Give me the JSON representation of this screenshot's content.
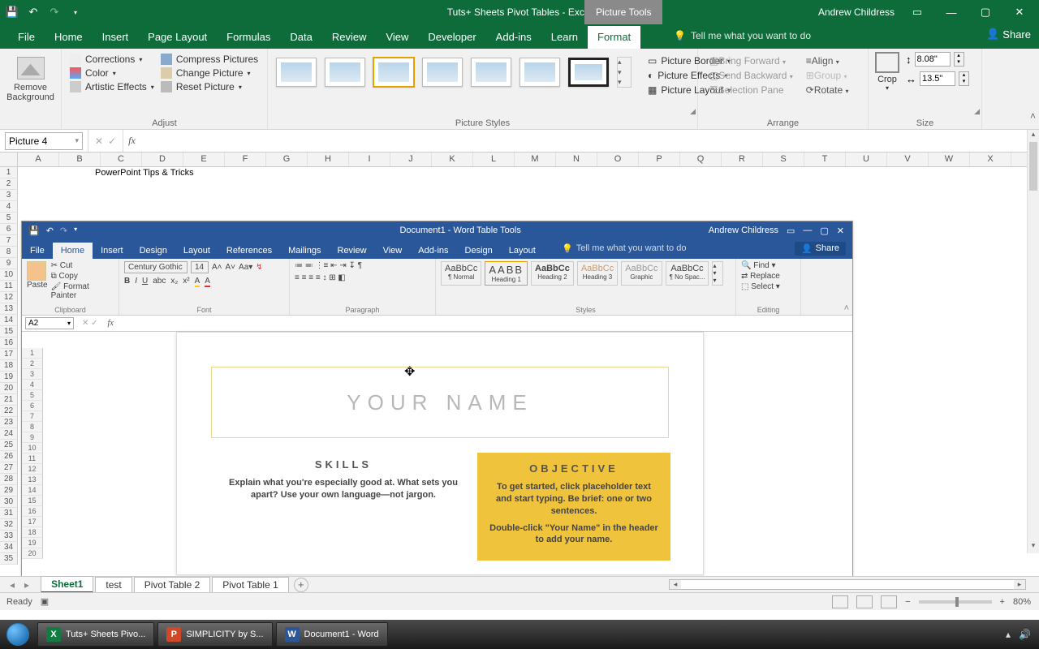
{
  "titlebar": {
    "doc_title": "Tuts+ Sheets Pivot Tables  -  Excel",
    "picture_tools": "Picture Tools",
    "user": "Andrew Childress"
  },
  "tabs": {
    "file": "File",
    "home": "Home",
    "insert": "Insert",
    "page_layout": "Page Layout",
    "formulas": "Formulas",
    "data": "Data",
    "review": "Review",
    "view": "View",
    "developer": "Developer",
    "addins": "Add-ins",
    "learn": "Learn",
    "format": "Format",
    "tell_me": "Tell me what you want to do",
    "share": "Share"
  },
  "ribbon": {
    "remove_bg": "Remove Background",
    "corrections": "Corrections",
    "color": "Color",
    "artistic": "Artistic Effects",
    "compress": "Compress Pictures",
    "change": "Change Picture",
    "reset": "Reset Picture",
    "adjust_label": "Adjust",
    "styles_label": "Picture Styles",
    "border": "Picture Border",
    "effects": "Picture Effects",
    "layout": "Picture Layout",
    "bring_fwd": "Bring Forward",
    "send_back": "Send Backward",
    "selection": "Selection Pane",
    "align": "Align",
    "group": "Group",
    "rotate": "Rotate",
    "arrange_label": "Arrange",
    "crop": "Crop",
    "height": "8.08\"",
    "width": "13.5\"",
    "size_label": "Size"
  },
  "formula": {
    "name_box": "Picture 4"
  },
  "columns": [
    "A",
    "B",
    "C",
    "D",
    "E",
    "F",
    "G",
    "H",
    "I",
    "J",
    "K",
    "L",
    "M",
    "N",
    "O",
    "P",
    "Q",
    "R",
    "S",
    "T",
    "U",
    "V",
    "W",
    "X"
  ],
  "cell_a1_area": "PowerPoint Tips & Tricks",
  "word_pic": {
    "title_doc": "Document1  -  Word",
    "table_tools": "Table Tools",
    "user": "Andrew Childress",
    "tabs": {
      "file": "File",
      "home": "Home",
      "insert": "Insert",
      "design": "Design",
      "layout": "Layout",
      "references": "References",
      "mailings": "Mailings",
      "review": "Review",
      "view": "View",
      "addins": "Add-ins",
      "design2": "Design",
      "layout2": "Layout"
    },
    "tellme": "Tell me what you want to do",
    "share": "Share",
    "font_name": "Century Gothic",
    "font_size": "14",
    "name_box": "A2",
    "groups": {
      "clipboard": "Clipboard",
      "font": "Font",
      "paragraph": "Paragraph",
      "styles": "Styles",
      "editing": "Editing"
    },
    "paste": "Paste",
    "cut": "Cut",
    "copy": "Copy",
    "fp": "Format Painter",
    "find": "Find",
    "replace": "Replace",
    "select": "Select",
    "style_labels": [
      "¶ Normal",
      "Heading 1",
      "Heading 2",
      "Heading 3",
      "Graphic",
      "¶ No Spac..."
    ],
    "your_name": "YOUR NAME",
    "skills_hd": "SKILLS",
    "skills_body": "Explain what you're especially good at. What sets you apart? Use your own language—not jargon.",
    "obj_hd": "OBJECTIVE",
    "obj_body1": "To get started, click placeholder text and start typing. Be brief: one or two sentences.",
    "obj_body2": "Double-click \"Your Name\" in the header to add your name."
  },
  "sheets": {
    "s1": "Sheet1",
    "s2": "test",
    "s3": "Pivot Table 2",
    "s4": "Pivot Table 1"
  },
  "status": {
    "ready": "Ready",
    "zoom": "80%"
  },
  "taskbar": {
    "t1": "Tuts+ Sheets Pivo...",
    "t2": "SIMPLICITY by S...",
    "t3": "Document1 - Word"
  }
}
